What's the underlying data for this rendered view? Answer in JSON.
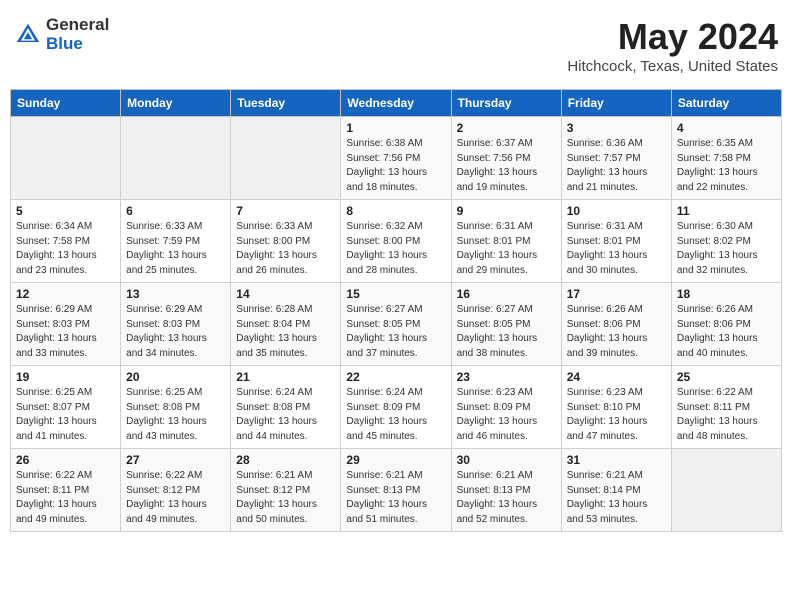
{
  "header": {
    "logo_general": "General",
    "logo_blue": "Blue",
    "month_title": "May 2024",
    "location": "Hitchcock, Texas, United States"
  },
  "weekdays": [
    "Sunday",
    "Monday",
    "Tuesday",
    "Wednesday",
    "Thursday",
    "Friday",
    "Saturday"
  ],
  "weeks": [
    [
      {
        "day": "",
        "info": ""
      },
      {
        "day": "",
        "info": ""
      },
      {
        "day": "",
        "info": ""
      },
      {
        "day": "1",
        "info": "Sunrise: 6:38 AM\nSunset: 7:56 PM\nDaylight: 13 hours\nand 18 minutes."
      },
      {
        "day": "2",
        "info": "Sunrise: 6:37 AM\nSunset: 7:56 PM\nDaylight: 13 hours\nand 19 minutes."
      },
      {
        "day": "3",
        "info": "Sunrise: 6:36 AM\nSunset: 7:57 PM\nDaylight: 13 hours\nand 21 minutes."
      },
      {
        "day": "4",
        "info": "Sunrise: 6:35 AM\nSunset: 7:58 PM\nDaylight: 13 hours\nand 22 minutes."
      }
    ],
    [
      {
        "day": "5",
        "info": "Sunrise: 6:34 AM\nSunset: 7:58 PM\nDaylight: 13 hours\nand 23 minutes."
      },
      {
        "day": "6",
        "info": "Sunrise: 6:33 AM\nSunset: 7:59 PM\nDaylight: 13 hours\nand 25 minutes."
      },
      {
        "day": "7",
        "info": "Sunrise: 6:33 AM\nSunset: 8:00 PM\nDaylight: 13 hours\nand 26 minutes."
      },
      {
        "day": "8",
        "info": "Sunrise: 6:32 AM\nSunset: 8:00 PM\nDaylight: 13 hours\nand 28 minutes."
      },
      {
        "day": "9",
        "info": "Sunrise: 6:31 AM\nSunset: 8:01 PM\nDaylight: 13 hours\nand 29 minutes."
      },
      {
        "day": "10",
        "info": "Sunrise: 6:31 AM\nSunset: 8:01 PM\nDaylight: 13 hours\nand 30 minutes."
      },
      {
        "day": "11",
        "info": "Sunrise: 6:30 AM\nSunset: 8:02 PM\nDaylight: 13 hours\nand 32 minutes."
      }
    ],
    [
      {
        "day": "12",
        "info": "Sunrise: 6:29 AM\nSunset: 8:03 PM\nDaylight: 13 hours\nand 33 minutes."
      },
      {
        "day": "13",
        "info": "Sunrise: 6:29 AM\nSunset: 8:03 PM\nDaylight: 13 hours\nand 34 minutes."
      },
      {
        "day": "14",
        "info": "Sunrise: 6:28 AM\nSunset: 8:04 PM\nDaylight: 13 hours\nand 35 minutes."
      },
      {
        "day": "15",
        "info": "Sunrise: 6:27 AM\nSunset: 8:05 PM\nDaylight: 13 hours\nand 37 minutes."
      },
      {
        "day": "16",
        "info": "Sunrise: 6:27 AM\nSunset: 8:05 PM\nDaylight: 13 hours\nand 38 minutes."
      },
      {
        "day": "17",
        "info": "Sunrise: 6:26 AM\nSunset: 8:06 PM\nDaylight: 13 hours\nand 39 minutes."
      },
      {
        "day": "18",
        "info": "Sunrise: 6:26 AM\nSunset: 8:06 PM\nDaylight: 13 hours\nand 40 minutes."
      }
    ],
    [
      {
        "day": "19",
        "info": "Sunrise: 6:25 AM\nSunset: 8:07 PM\nDaylight: 13 hours\nand 41 minutes."
      },
      {
        "day": "20",
        "info": "Sunrise: 6:25 AM\nSunset: 8:08 PM\nDaylight: 13 hours\nand 43 minutes."
      },
      {
        "day": "21",
        "info": "Sunrise: 6:24 AM\nSunset: 8:08 PM\nDaylight: 13 hours\nand 44 minutes."
      },
      {
        "day": "22",
        "info": "Sunrise: 6:24 AM\nSunset: 8:09 PM\nDaylight: 13 hours\nand 45 minutes."
      },
      {
        "day": "23",
        "info": "Sunrise: 6:23 AM\nSunset: 8:09 PM\nDaylight: 13 hours\nand 46 minutes."
      },
      {
        "day": "24",
        "info": "Sunrise: 6:23 AM\nSunset: 8:10 PM\nDaylight: 13 hours\nand 47 minutes."
      },
      {
        "day": "25",
        "info": "Sunrise: 6:22 AM\nSunset: 8:11 PM\nDaylight: 13 hours\nand 48 minutes."
      }
    ],
    [
      {
        "day": "26",
        "info": "Sunrise: 6:22 AM\nSunset: 8:11 PM\nDaylight: 13 hours\nand 49 minutes."
      },
      {
        "day": "27",
        "info": "Sunrise: 6:22 AM\nSunset: 8:12 PM\nDaylight: 13 hours\nand 49 minutes."
      },
      {
        "day": "28",
        "info": "Sunrise: 6:21 AM\nSunset: 8:12 PM\nDaylight: 13 hours\nand 50 minutes."
      },
      {
        "day": "29",
        "info": "Sunrise: 6:21 AM\nSunset: 8:13 PM\nDaylight: 13 hours\nand 51 minutes."
      },
      {
        "day": "30",
        "info": "Sunrise: 6:21 AM\nSunset: 8:13 PM\nDaylight: 13 hours\nand 52 minutes."
      },
      {
        "day": "31",
        "info": "Sunrise: 6:21 AM\nSunset: 8:14 PM\nDaylight: 13 hours\nand 53 minutes."
      },
      {
        "day": "",
        "info": ""
      }
    ]
  ]
}
